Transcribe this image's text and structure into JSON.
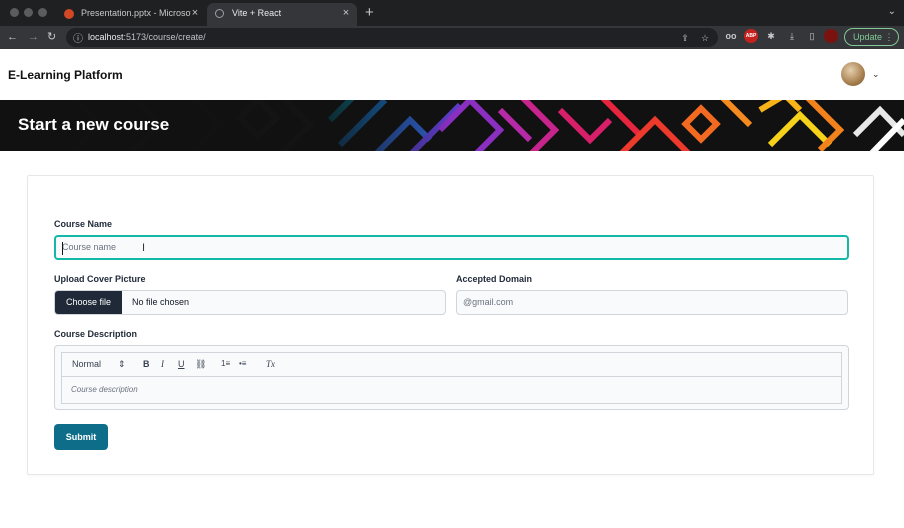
{
  "browser": {
    "tabs": [
      {
        "title": "Presentation.pptx - Microsoft P",
        "active": false,
        "favicon": "powerpoint-icon",
        "favicon_color": "#d24726"
      },
      {
        "title": "Vite + React",
        "active": true,
        "favicon": "globe-icon",
        "favicon_color": "#9aa0a6"
      }
    ],
    "tab_close": "×",
    "new_tab": "+",
    "tab_menu": "⌄",
    "nav": {
      "back": "←",
      "forward": "→",
      "reload": "↻"
    },
    "url_host": "localhost",
    "url_path": ":5173/course/create/",
    "info_icon": "ⓘ",
    "extensions": {
      "share": "⇪",
      "star": "☆",
      "glasses": "oo",
      "abp": "ABP",
      "puzzle": "✱",
      "download": "⤓",
      "sidebar": "▯"
    },
    "update_label": "Update",
    "update_menu": "⋮"
  },
  "app": {
    "brand": "E-Learning Platform",
    "avatar_chevron": "⌄"
  },
  "hero": {
    "title": "Start a new course"
  },
  "form": {
    "course_name": {
      "label": "Course Name",
      "placeholder": "Course name",
      "value": ""
    },
    "cover": {
      "label": "Upload Cover Picture",
      "button": "Choose file",
      "status": "No file chosen"
    },
    "domain": {
      "label": "Accepted Domain",
      "placeholder": "@gmail.com",
      "value": ""
    },
    "description": {
      "label": "Course Description",
      "format_select": "Normal",
      "select_arrows": "⇕",
      "tools": {
        "bold": "B",
        "italic": "I",
        "underline": "U",
        "link": "⛓",
        "ordered_list": "1≡",
        "bullet_list": "•≡",
        "clean": "Tx"
      },
      "placeholder": "Course description"
    },
    "submit_label": "Submit"
  },
  "colors": {
    "accent": "#0e6e8a",
    "focus_ring": "#14b8a6",
    "file_button": "#1f2937",
    "update_green": "#81c995"
  }
}
